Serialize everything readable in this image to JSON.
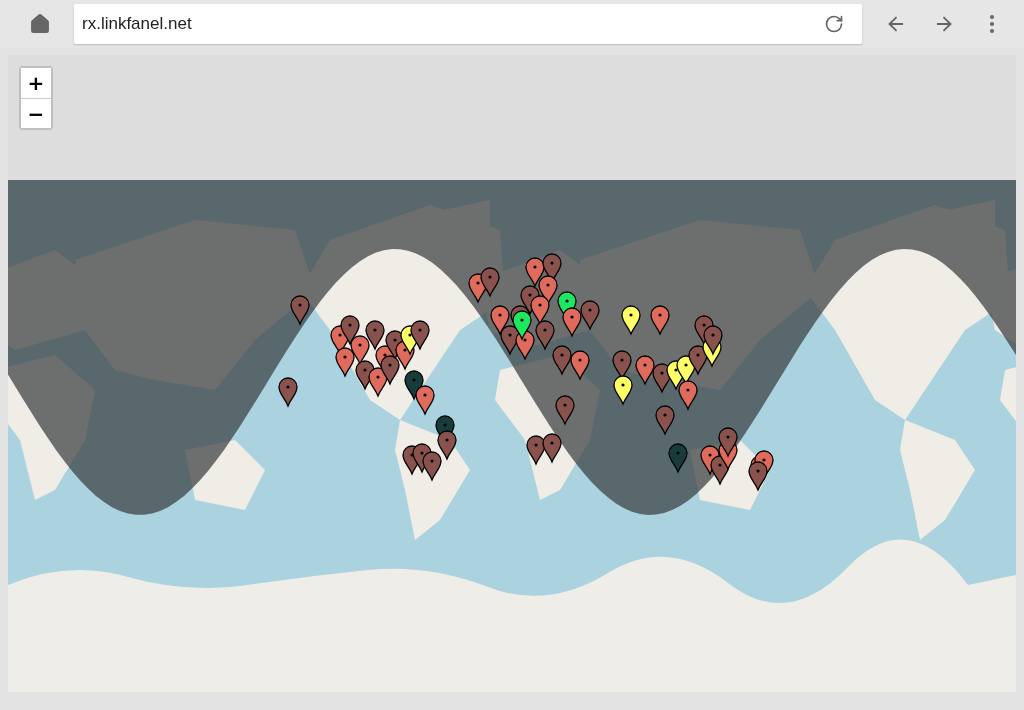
{
  "browser": {
    "address": "rx.linkfanel.net"
  },
  "map": {
    "zoom_controls": [
      "+",
      "−"
    ]
  }
}
